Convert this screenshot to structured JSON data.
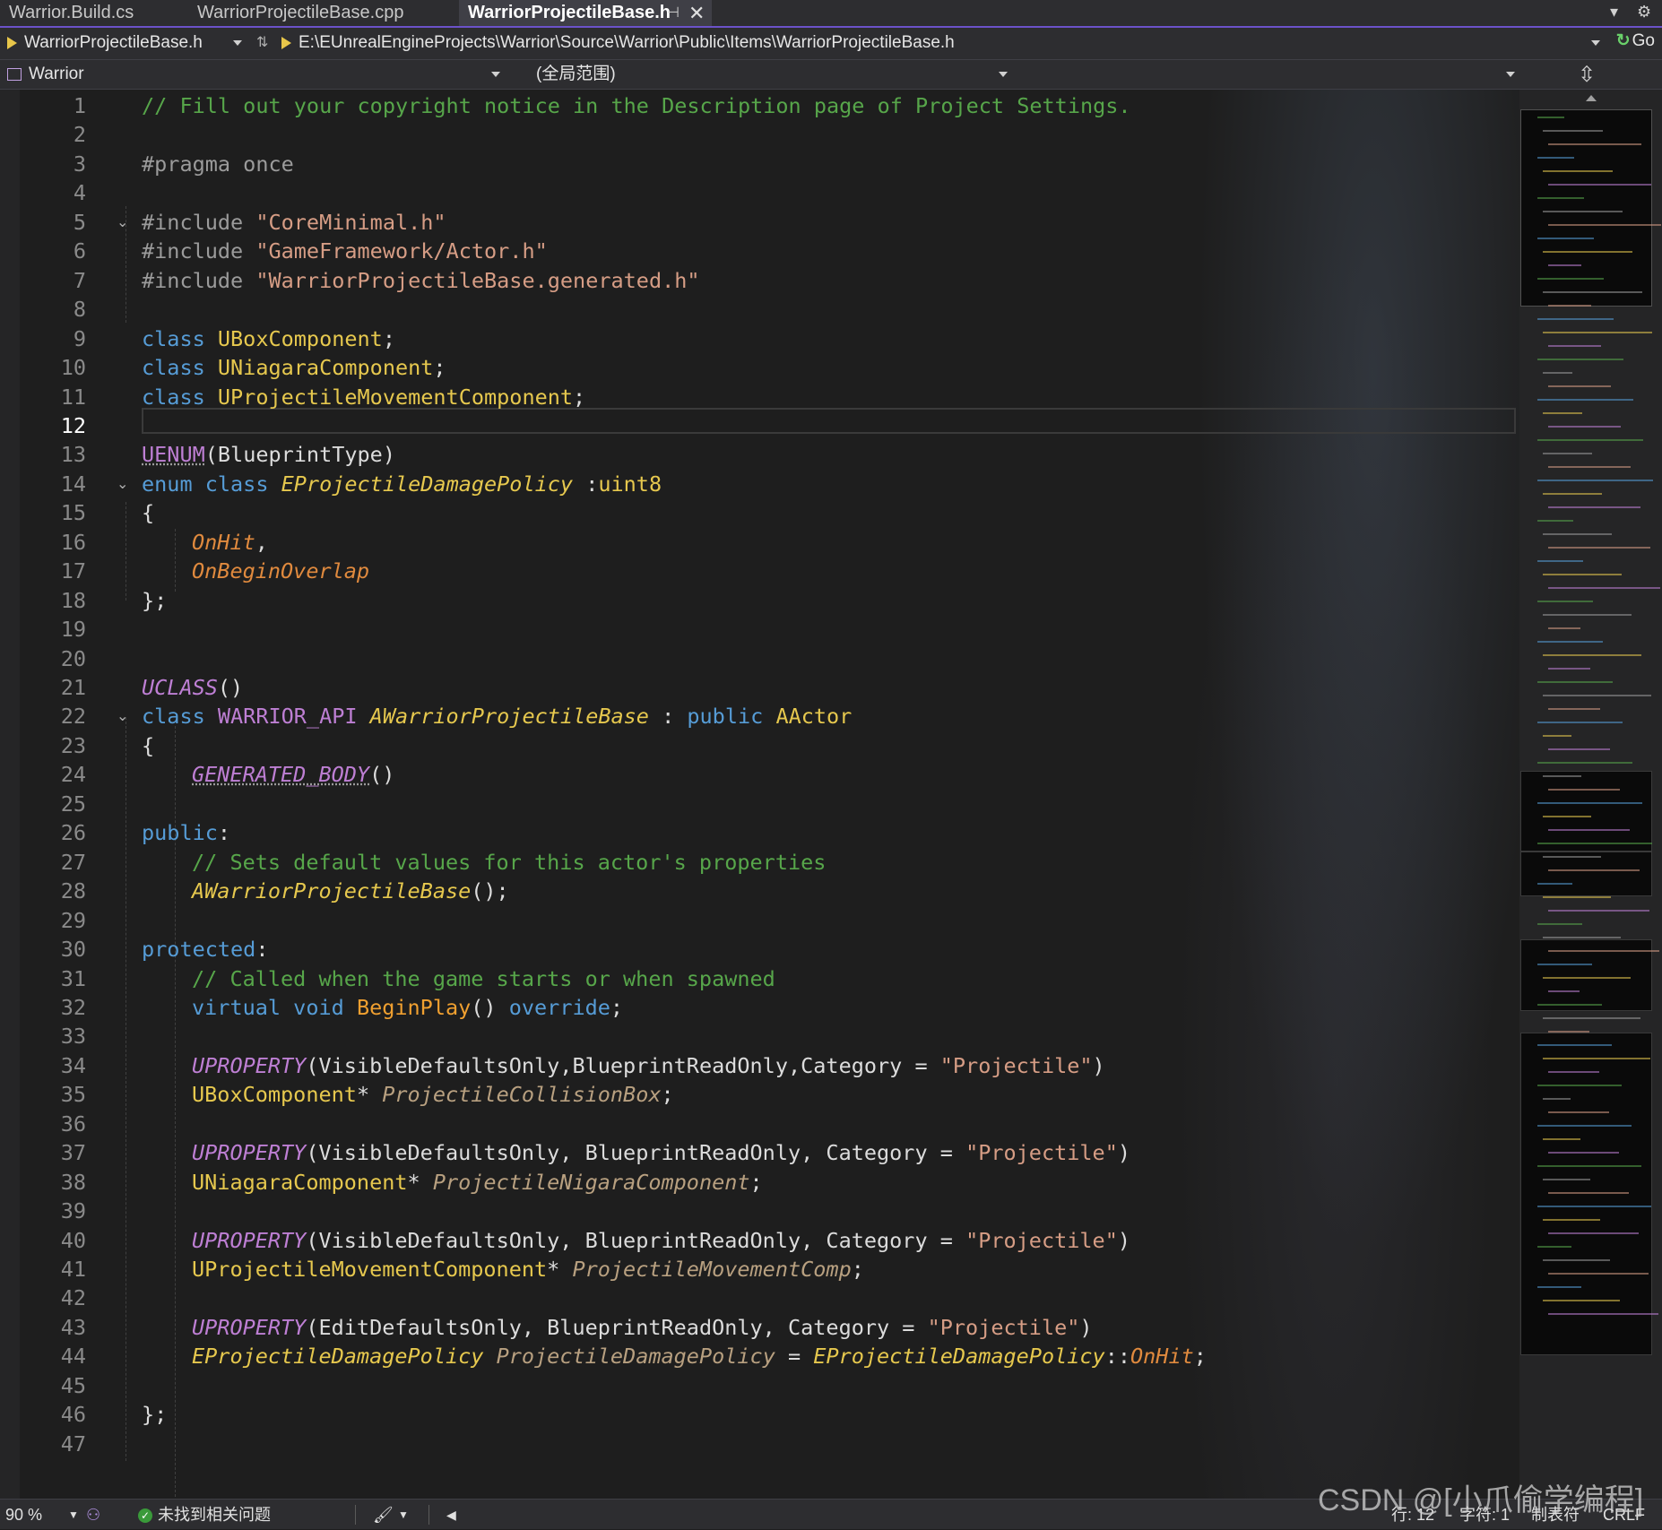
{
  "tabs": [
    {
      "label": "Warrior.Build.cs",
      "active": false
    },
    {
      "label": "WarriorProjectileBase.cpp",
      "active": false
    },
    {
      "label": "WarriorProjectileBase.h",
      "active": true
    }
  ],
  "tab_controls": {
    "pin": "⊣",
    "close": "✕",
    "overflow": "▾",
    "settings": "⚙"
  },
  "navbar": {
    "file_combo": "WarriorProjectileBase.h",
    "path": "E:\\EUnrealEngineProjects\\Warrior\\Source\\Warrior\\Public\\Items\\WarriorProjectileBase.h",
    "go_label": "Go"
  },
  "navbar2": {
    "project": "Warrior",
    "scope": "(全局范围)",
    "member": ""
  },
  "current_line": 12,
  "lines": [
    {
      "n": "1"
    },
    {
      "n": "2"
    },
    {
      "n": "3"
    },
    {
      "n": "4"
    },
    {
      "n": "5"
    },
    {
      "n": "6"
    },
    {
      "n": "7"
    },
    {
      "n": "8"
    },
    {
      "n": "9"
    },
    {
      "n": "10"
    },
    {
      "n": "11"
    },
    {
      "n": "12"
    },
    {
      "n": "13"
    },
    {
      "n": "14"
    },
    {
      "n": "15"
    },
    {
      "n": "16"
    },
    {
      "n": "17"
    },
    {
      "n": "18"
    },
    {
      "n": "19"
    },
    {
      "n": "20"
    },
    {
      "n": "21"
    },
    {
      "n": "22"
    },
    {
      "n": "23"
    },
    {
      "n": "24"
    },
    {
      "n": "25"
    },
    {
      "n": "26"
    },
    {
      "n": "27"
    },
    {
      "n": "28"
    },
    {
      "n": "29"
    },
    {
      "n": "30"
    },
    {
      "n": "31"
    },
    {
      "n": "32"
    },
    {
      "n": "33"
    },
    {
      "n": "34"
    },
    {
      "n": "35"
    },
    {
      "n": "36"
    },
    {
      "n": "37"
    },
    {
      "n": "38"
    },
    {
      "n": "39"
    },
    {
      "n": "40"
    },
    {
      "n": "41"
    },
    {
      "n": "42"
    },
    {
      "n": "43"
    },
    {
      "n": "44"
    },
    {
      "n": "45"
    },
    {
      "n": "46"
    },
    {
      "n": "47"
    }
  ],
  "code": {
    "l1": "// Fill out your copyright notice in the Description page of Project Settings.",
    "l3": "#pragma once",
    "l5a": "#include ",
    "l5b": "\"CoreMinimal.h\"",
    "l6a": "#include ",
    "l6b": "\"GameFramework/Actor.h\"",
    "l7a": "#include ",
    "l7b": "\"WarriorProjectileBase.generated.h\"",
    "l9a": "class ",
    "l9b": "UBoxComponent",
    "l9c": ";",
    "l10a": "class ",
    "l10b": "UNiagaraComponent",
    "l10c": ";",
    "l11a": "class ",
    "l11b": "UProjectileMovementComponent",
    "l11c": ";",
    "l13a": "UENUM",
    "l13b": "(BlueprintType)",
    "l14a": "enum class ",
    "l14b": "EProjectileDamagePolicy",
    "l14c": " :",
    "l14d": "uint8",
    "l15": "{",
    "l16a": "OnHit",
    "l16b": ",",
    "l17": "OnBeginOverlap",
    "l18": "};",
    "l21a": "UCLASS",
    "l21b": "()",
    "l22a": "class ",
    "l22b": "WARRIOR_API ",
    "l22c": "AWarriorProjectileBase",
    "l22d": " : ",
    "l22e": "public ",
    "l22f": "AActor",
    "l23": "{",
    "l24a": "GENERATED_BODY",
    "l24b": "()",
    "l26a": "public",
    "l26b": ":",
    "l27": "// Sets default values for this actor's properties",
    "l28a": "AWarriorProjectileBase",
    "l28b": "();",
    "l30a": "protected",
    "l30b": ":",
    "l31": "// Called when the game starts or when spawned",
    "l32a": "virtual void ",
    "l32b": "BeginPlay",
    "l32c": "() ",
    "l32d": "override",
    "l32e": ";",
    "l34a": "UPROPERTY",
    "l34b": "(VisibleDefaultsOnly,BlueprintReadOnly,Category = ",
    "l34c": "\"Projectile\"",
    "l34d": ")",
    "l35a": "UBoxComponent",
    "l35b": "* ",
    "l35c": "ProjectileCollisionBox",
    "l35d": ";",
    "l37a": "UPROPERTY",
    "l37b": "(VisibleDefaultsOnly, BlueprintReadOnly, Category = ",
    "l37c": "\"Projectile\"",
    "l37d": ")",
    "l38a": "UNiagaraComponent",
    "l38b": "* ",
    "l38c": "ProjectileNigaraComponent",
    "l38d": ";",
    "l40a": "UPROPERTY",
    "l40b": "(VisibleDefaultsOnly, BlueprintReadOnly, Category = ",
    "l40c": "\"Projectile\"",
    "l40d": ")",
    "l41a": "UProjectileMovementComponent",
    "l41b": "* ",
    "l41c": "ProjectileMovementComp",
    "l41d": ";",
    "l43a": "UPROPERTY",
    "l43b": "(EditDefaultsOnly, BlueprintReadOnly, Category = ",
    "l43c": "\"Projectile\"",
    "l43d": ")",
    "l44a": "EProjectileDamagePolicy",
    "l44b": " ",
    "l44c": "ProjectileDamagePolicy",
    "l44d": " = ",
    "l44e": "EProjectileDamagePolicy",
    "l44f": "::",
    "l44g": "OnHit",
    "l44h": ";",
    "l46": "};"
  },
  "status": {
    "zoom": "90 %",
    "issues": "未找到相关问题",
    "line": "行: 12",
    "char": "字符: 1",
    "tabs": "制表符",
    "eol": "CRLF"
  },
  "watermark": "CSDN @[小爪偷学编程]",
  "colors": {
    "comment": "#57a64a",
    "keyword": "#569cd6",
    "type": "#e6c84e",
    "macro": "#be7fd4",
    "string": "#d69d85",
    "enum_member": "#e08a3e",
    "accent": "#6b52c9"
  }
}
